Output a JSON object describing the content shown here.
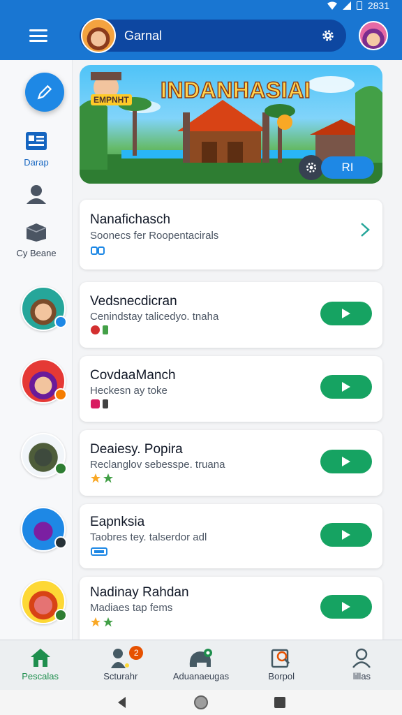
{
  "status_bar": {
    "time": "2831"
  },
  "app_bar": {
    "title": "Garnal"
  },
  "sidebar": {
    "items": [
      {
        "label": "Darap"
      },
      {
        "label": ""
      },
      {
        "label": "Cy Beane"
      }
    ]
  },
  "banner": {
    "title": "INDANHASIAI",
    "small_sign": "EMPNHT",
    "button_label": "RI"
  },
  "cards": [
    {
      "title": "Nanafichasch",
      "subtitle": "Soonecs fer Roopentacirals"
    },
    {
      "title": "Vedsnecdicran",
      "subtitle": "Cenindstay talicedyo. tnaha"
    },
    {
      "title": "CovdaaManch",
      "subtitle": "Heckesn ay toke"
    },
    {
      "title": "Deaiesy. Popira",
      "subtitle": "Reclanglov sebesspe. truana"
    },
    {
      "title": "Eapnksia",
      "subtitle": "Taobres tey. talserdor adl"
    },
    {
      "title": "Nadinay Rahdan",
      "subtitle": "Madiaes tap fems"
    }
  ],
  "bottom_nav": {
    "items": [
      {
        "label": "Pescalas"
      },
      {
        "label": "Scturahr",
        "badge": "2"
      },
      {
        "label": "Aduanaeugas"
      },
      {
        "label": "Borpol"
      },
      {
        "label": "lillas"
      }
    ]
  },
  "colors": {
    "primary": "#1976d2",
    "play": "#16a362",
    "active_nav": "#1e8e4d"
  }
}
